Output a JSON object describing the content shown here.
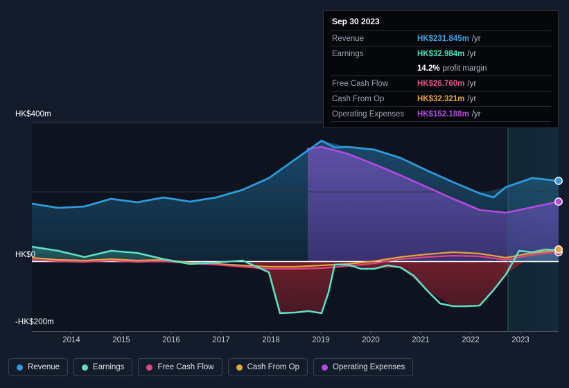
{
  "currency_prefix": "HK$",
  "axes": {
    "y_labels": [
      "HK$400m",
      "HK$0",
      "-HK$200m"
    ],
    "y_values": [
      400,
      0,
      -200
    ],
    "x_labels": [
      "2014",
      "2015",
      "2016",
      "2017",
      "2018",
      "2019",
      "2020",
      "2021",
      "2022",
      "2023"
    ]
  },
  "tooltip": {
    "date": "Sep 30 2023",
    "rows": [
      {
        "key": "Revenue",
        "value": "HK$231.845m",
        "unit": "/yr",
        "color": "#3aa8e8"
      },
      {
        "key": "Earnings",
        "value": "HK$32.984m",
        "unit": "/yr",
        "color": "#4ee0bd"
      },
      {
        "key": "",
        "value": "14.2%",
        "sub": "profit margin",
        "color": "#ffffff"
      },
      {
        "key": "Free Cash Flow",
        "value": "HK$26.760m",
        "unit": "/yr",
        "color": "#e0538a"
      },
      {
        "key": "Cash From Op",
        "value": "HK$32.321m",
        "unit": "/yr",
        "color": "#e8a33d"
      },
      {
        "key": "Operating Expenses",
        "value": "HK$152.188m",
        "unit": "/yr",
        "color": "#b44ae0"
      }
    ]
  },
  "legend": [
    {
      "label": "Revenue",
      "color": "#2e9ad8"
    },
    {
      "label": "Earnings",
      "color": "#5fe0c2"
    },
    {
      "label": "Free Cash Flow",
      "color": "#e0467f"
    },
    {
      "label": "Cash From Op",
      "color": "#e8a33d"
    },
    {
      "label": "Operating Expenses",
      "color": "#b44ae0"
    }
  ],
  "chart_data": {
    "type": "area",
    "title": "",
    "xlabel": "",
    "ylabel": "HK$",
    "ylim": [
      -240,
      460
    ],
    "grid": true,
    "legend_position": "bottom",
    "units": "HK$ millions per year",
    "x": [
      2013.5,
      2014,
      2014.5,
      2015,
      2015.5,
      2016,
      2016.5,
      2017,
      2017.5,
      2018,
      2018.5,
      2019,
      2019.5,
      2020,
      2020.5,
      2021,
      2021.5,
      2022,
      2022.5,
      2023,
      2023.75
    ],
    "x_tick_values": [
      2014,
      2015,
      2016,
      2017,
      2018,
      2019,
      2020,
      2021,
      2022,
      2023
    ],
    "forecast_boundary_x": 2022.6,
    "series": [
      {
        "name": "Revenue",
        "color": "#2e9ad8",
        "values": [
          168,
          160,
          164,
          186,
          176,
          190,
          178,
          190,
          212,
          246,
          300,
          348,
          330,
          322,
          298,
          262,
          228,
          196,
          214,
          240,
          260
        ]
      },
      {
        "name": "Earnings",
        "color": "#5fe0c2",
        "values": [
          42,
          30,
          12,
          30,
          24,
          6,
          -8,
          -4,
          2,
          -32,
          -150,
          -148,
          -10,
          -22,
          -18,
          -84,
          -130,
          -128,
          -38,
          26,
          33
        ]
      },
      {
        "name": "Free Cash Flow",
        "color": "#e0467f",
        "values": [
          4,
          0,
          -2,
          2,
          -2,
          0,
          -6,
          -10,
          -16,
          -22,
          -22,
          -20,
          -14,
          -6,
          6,
          12,
          16,
          14,
          4,
          18,
          27
        ]
      },
      {
        "name": "Cash From Op",
        "color": "#e8a33d",
        "values": [
          10,
          4,
          2,
          6,
          2,
          4,
          -4,
          -8,
          -12,
          -16,
          -16,
          -12,
          -8,
          0,
          12,
          20,
          26,
          22,
          10,
          24,
          32
        ]
      },
      {
        "name": "Operating Expenses",
        "color": "#b44ae0",
        "values": [
          null,
          null,
          null,
          null,
          null,
          null,
          null,
          null,
          null,
          null,
          324,
          330,
          310,
          280,
          248,
          214,
          180,
          148,
          140,
          156,
          172
        ]
      }
    ],
    "endpoint_markers": [
      {
        "series": "Revenue",
        "value": 231.845
      },
      {
        "series": "Operating Expenses",
        "value": 152.188
      },
      {
        "series": "Cash From Op",
        "value": 32.321
      },
      {
        "series": "Free Cash Flow",
        "value": 26.76
      }
    ]
  }
}
